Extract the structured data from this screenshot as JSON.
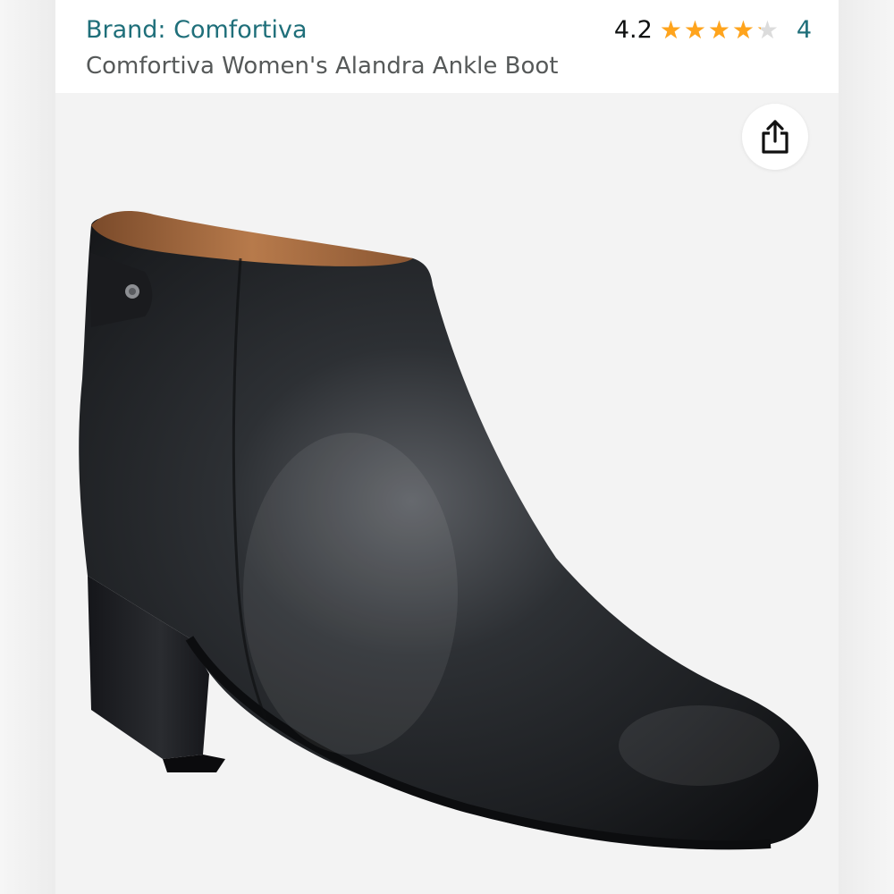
{
  "header": {
    "brand_label": "Brand: Comfortiva",
    "title": "Comfortiva Women's Alandra Ankle Boot",
    "rating": {
      "value": "4.2",
      "stars_filled": 4.2,
      "stars_max": 5,
      "review_count": "4"
    }
  },
  "icons": {
    "share": "share-icon",
    "star": "star-icon"
  },
  "colors": {
    "brand_link": "#1f6f7a",
    "title_text": "#565959",
    "star_fill": "#ffa41c",
    "star_empty": "#dcdcdc",
    "image_background": "#f3f3f3"
  },
  "product_image": {
    "subject": "black leather ankle boot"
  }
}
